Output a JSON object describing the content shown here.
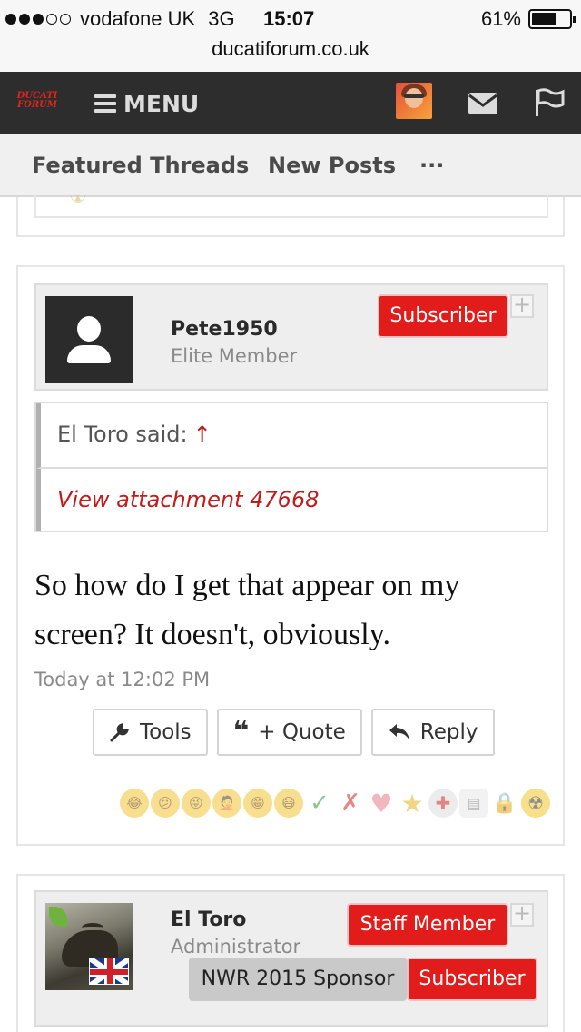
{
  "status_bar": {
    "carrier": "vodafone UK",
    "network": "3G",
    "time": "15:07",
    "battery": "61%",
    "signal_bars_filled": 3,
    "signal_bars_total": 5
  },
  "url": "ducatiforum.co.uk",
  "nav": {
    "logo_line1": "DUCATI",
    "logo_line2": "FORUM",
    "menu_label": "MENU",
    "icons": [
      "hamburger-icon",
      "user-avatar",
      "mail-icon",
      "flag-icon"
    ]
  },
  "tabs": [
    {
      "label": "Featured Threads"
    },
    {
      "label": "New Posts"
    },
    {
      "label": "..."
    }
  ],
  "posts": [
    {
      "username": "Pete1950",
      "user_title": "Elite Member",
      "badges": [
        "Subscriber"
      ],
      "quote": {
        "said": "El Toro said:",
        "arrow": "↑",
        "link": "View attachment 47668"
      },
      "message": "So how do I get that appear on my screen? It doesn't, obviously.",
      "time": "Today at 12:02 PM",
      "actions": {
        "tools": "Tools",
        "quote": "+ Quote",
        "reply": "Reply"
      }
    },
    {
      "username": "El Toro",
      "user_title": "Administrator",
      "badges": [
        "Staff Member",
        "NWR 2015 Sponsor",
        "Subscriber"
      ]
    }
  ],
  "colors": {
    "nav_bg": "#2d2d2d",
    "badge_red": "#e21b1b",
    "link_red": "#c31a1a"
  }
}
